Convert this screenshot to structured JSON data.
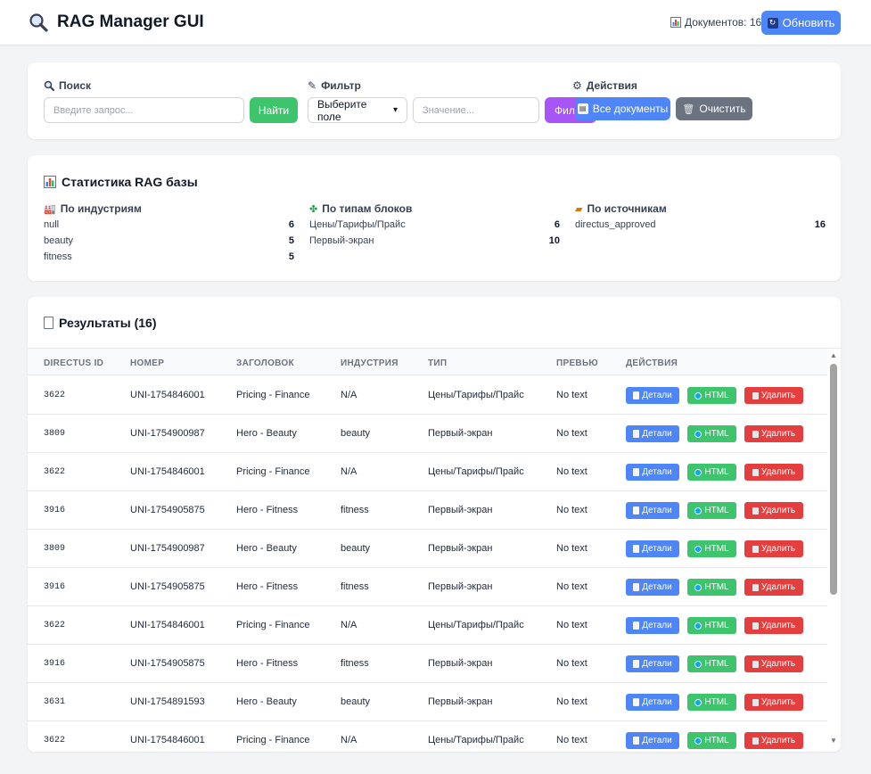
{
  "header": {
    "icon": "magnifier-icon",
    "title": "RAG Manager GUI",
    "doc_count_label": "Документов: 16",
    "refresh_label": "Обновить"
  },
  "search": {
    "search_label": "Поиск",
    "search_placeholder": "Введите запрос...",
    "find_label": "Найти",
    "filter_label": "Фильтр",
    "filter_select": "Выберите поле",
    "value_placeholder": "Значение...",
    "filter_button": "Фил",
    "actions_label": "Действия",
    "all_docs_label": "Все документы",
    "clear_label": "Очистить"
  },
  "stats": {
    "title": "Статистика RAG базы",
    "industries": {
      "title": "По индустриям",
      "items": [
        {
          "name": "null",
          "count": "6"
        },
        {
          "name": "beauty",
          "count": "5"
        },
        {
          "name": "fitness",
          "count": "5"
        }
      ]
    },
    "block_types": {
      "title": "По типам блоков",
      "items": [
        {
          "name": "Цены/Тарифы/Прайс",
          "count": "6"
        },
        {
          "name": "Первый-экран",
          "count": "10"
        }
      ]
    },
    "sources": {
      "title": "По источникам",
      "items": [
        {
          "name": "directus_approved",
          "count": "16"
        }
      ]
    }
  },
  "results": {
    "title": "Результаты (16)",
    "columns": [
      "DIRECTUS ID",
      "НОМЕР",
      "ЗАГОЛОВОК",
      "ИНДУСТРИЯ",
      "ТИП",
      "ПРЕВЬЮ",
      "ДЕЙСТВИЯ"
    ],
    "action_labels": {
      "details": "Детали",
      "html": "HTML",
      "delete": "Удалить"
    },
    "rows": [
      {
        "id": "3622",
        "number": "UNI-1754846001",
        "title": "Pricing - Finance",
        "industry": "N/A",
        "type": "Цены/Тарифы/Прайс",
        "preview": "No text"
      },
      {
        "id": "3809",
        "number": "UNI-1754900987",
        "title": "Hero - Beauty",
        "industry": "beauty",
        "type": "Первый-экран",
        "preview": "No text"
      },
      {
        "id": "3622",
        "number": "UNI-1754846001",
        "title": "Pricing - Finance",
        "industry": "N/A",
        "type": "Цены/Тарифы/Прайс",
        "preview": "No text"
      },
      {
        "id": "3916",
        "number": "UNI-1754905875",
        "title": "Hero - Fitness",
        "industry": "fitness",
        "type": "Первый-экран",
        "preview": "No text"
      },
      {
        "id": "3809",
        "number": "UNI-1754900987",
        "title": "Hero - Beauty",
        "industry": "beauty",
        "type": "Первый-экран",
        "preview": "No text"
      },
      {
        "id": "3916",
        "number": "UNI-1754905875",
        "title": "Hero - Fitness",
        "industry": "fitness",
        "type": "Первый-экран",
        "preview": "No text"
      },
      {
        "id": "3622",
        "number": "UNI-1754846001",
        "title": "Pricing - Finance",
        "industry": "N/A",
        "type": "Цены/Тарифы/Прайс",
        "preview": "No text"
      },
      {
        "id": "3916",
        "number": "UNI-1754905875",
        "title": "Hero - Fitness",
        "industry": "fitness",
        "type": "Первый-экран",
        "preview": "No text"
      },
      {
        "id": "3631",
        "number": "UNI-1754891593",
        "title": "Hero - Beauty",
        "industry": "beauty",
        "type": "Первый-экран",
        "preview": "No text"
      },
      {
        "id": "3622",
        "number": "UNI-1754846001",
        "title": "Pricing - Finance",
        "industry": "N/A",
        "type": "Цены/Тарифы/Прайс",
        "preview": "No text"
      }
    ]
  },
  "colors": {
    "primary": "#4f86f7",
    "success": "#3ec46d",
    "danger": "#e53e3e",
    "purple": "#a855f7",
    "gray_button": "#6b7280"
  }
}
